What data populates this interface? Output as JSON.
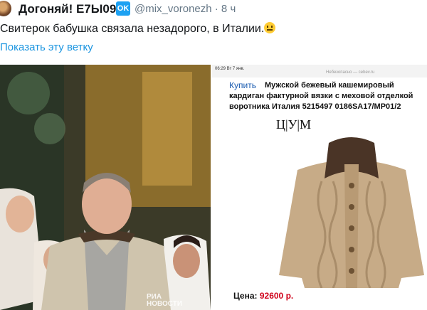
{
  "tweet": {
    "display_name": "Догоняй! Е7Ы09",
    "badge": "OK",
    "handle_time": "@mix_voronezh · 8 ч",
    "text": "Свитерок бабушка связала незадорого, в Италии.",
    "show_thread": "Показать эту ветку"
  },
  "listing": {
    "status_time": "06:29  Вт 7 янв.",
    "url": "Небезопасно — cebev.ru",
    "buy_label": "Купить",
    "title": "Мужской бежевый кашемировый кардиган фактурной вязки с меховой отделкой воротника Италия 5215497 0186SA17/MP01/2",
    "brand": "Ц|У|М",
    "price_label": "Цена:",
    "price_value": "92600 р."
  },
  "watermark": {
    "line1": "РИА",
    "line2": "НОВОСТИ"
  },
  "colors": {
    "link": "#1b95e0",
    "price": "#d0021b",
    "badge": "#1da1f2"
  }
}
